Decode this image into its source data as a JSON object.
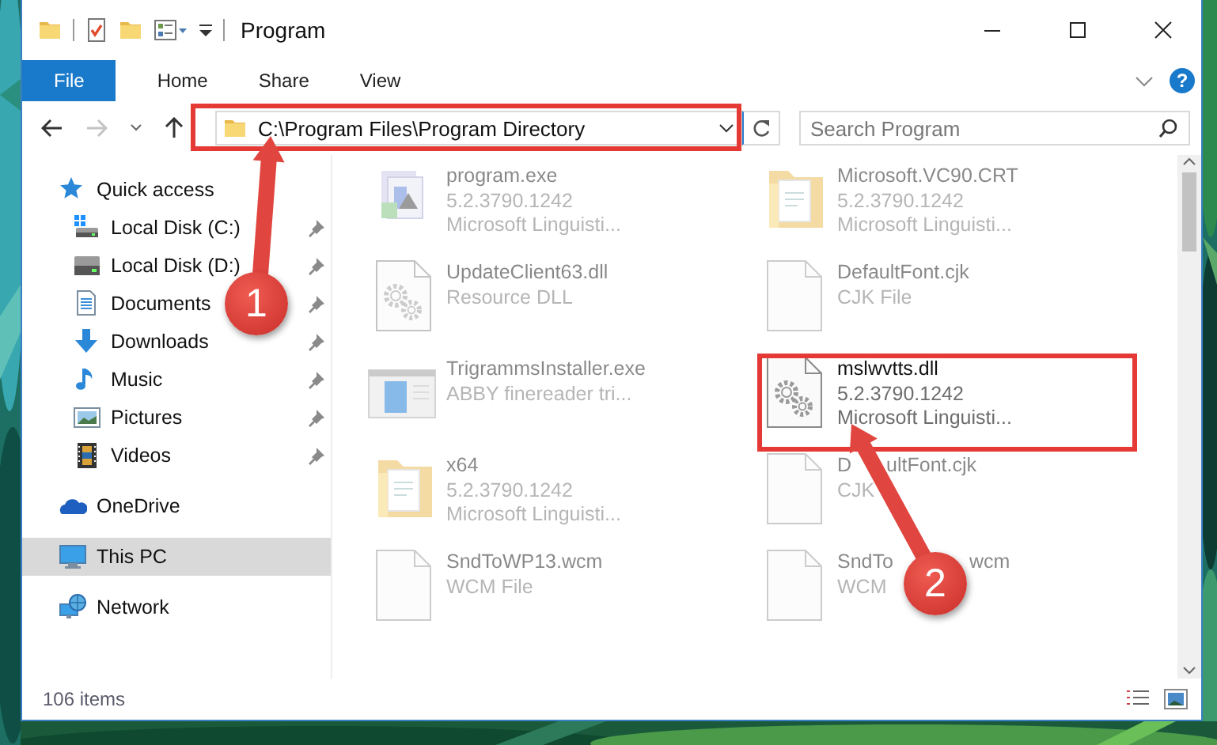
{
  "window": {
    "title": "Program"
  },
  "ribbon": {
    "tabs": [
      {
        "label": "File",
        "selected": true
      },
      {
        "label": "Home",
        "selected": false
      },
      {
        "label": "Share",
        "selected": false
      },
      {
        "label": "View",
        "selected": false
      }
    ],
    "help": "?"
  },
  "navigation": {
    "forward_disabled": true
  },
  "address": {
    "path": "C:\\Program Files\\Program Directory"
  },
  "search": {
    "placeholder": "Search Program"
  },
  "sidebar": {
    "items": [
      {
        "label": "Quick access",
        "kind": "star",
        "selected": false,
        "children": [
          {
            "label": "Local Disk (C:)",
            "kind": "system-drive",
            "pinned": true,
            "selected": false
          },
          {
            "label": "Local Disk (D:)",
            "kind": "drive",
            "pinned": true,
            "selected": false
          },
          {
            "label": "Documents",
            "kind": "documents",
            "pinned": true,
            "selected": false
          },
          {
            "label": "Downloads",
            "kind": "downloads",
            "pinned": true,
            "selected": false
          },
          {
            "label": "Music",
            "kind": "music",
            "pinned": true,
            "selected": false
          },
          {
            "label": "Pictures",
            "kind": "pictures",
            "pinned": true,
            "selected": false
          },
          {
            "label": "Videos",
            "kind": "videos",
            "pinned": true,
            "selected": false
          }
        ]
      },
      {
        "label": "OneDrive",
        "kind": "cloud",
        "selected": false
      },
      {
        "label": "This PC",
        "kind": "pc",
        "selected": true
      },
      {
        "label": "Network",
        "kind": "network",
        "selected": false
      }
    ]
  },
  "files": [
    {
      "name": "program.exe",
      "details": [
        "5.2.3790.1242",
        "Microsoft Linguisti..."
      ],
      "kind": "app",
      "dimmed": true
    },
    {
      "name": "Microsoft.VC90.CRT",
      "details": [
        "5.2.3790.1242",
        "Microsoft Linguisti..."
      ],
      "kind": "folder",
      "dimmed": true
    },
    {
      "name": "UpdateClient63.dll",
      "details": [
        "Resource DLL"
      ],
      "kind": "gears",
      "dimmed": true
    },
    {
      "name": "DefaultFont.cjk",
      "details": [
        "CJK File"
      ],
      "kind": "document",
      "dimmed": true
    },
    {
      "name": "TrigrammsInstaller.exe",
      "details": [
        "ABBY finereader tri..."
      ],
      "kind": "installer",
      "dimmed": true
    },
    {
      "name": "mslwvtts.dll",
      "details": [
        "5.2.3790.1242",
        "Microsoft Linguisti..."
      ],
      "kind": "gears",
      "dimmed": false
    },
    {
      "name": "x64",
      "details": [
        "5.2.3790.1242",
        "Microsoft Linguisti..."
      ],
      "kind": "folder",
      "dimmed": true
    },
    {
      "name_parts": [
        "D",
        "ultFont.cjk"
      ],
      "details": [
        "CJK"
      ],
      "kind": "document",
      "dimmed": true
    },
    {
      "name": "SndToWP13.wcm",
      "details": [
        "WCM File"
      ],
      "kind": "document",
      "dimmed": true
    },
    {
      "name_parts": [
        "SndTo",
        "wcm"
      ],
      "details": [
        "WCM"
      ],
      "kind": "document",
      "dimmed": true
    }
  ],
  "status_bar": {
    "count": "106 items"
  },
  "annotations": [
    {
      "number": "1"
    },
    {
      "number": "2"
    }
  ]
}
